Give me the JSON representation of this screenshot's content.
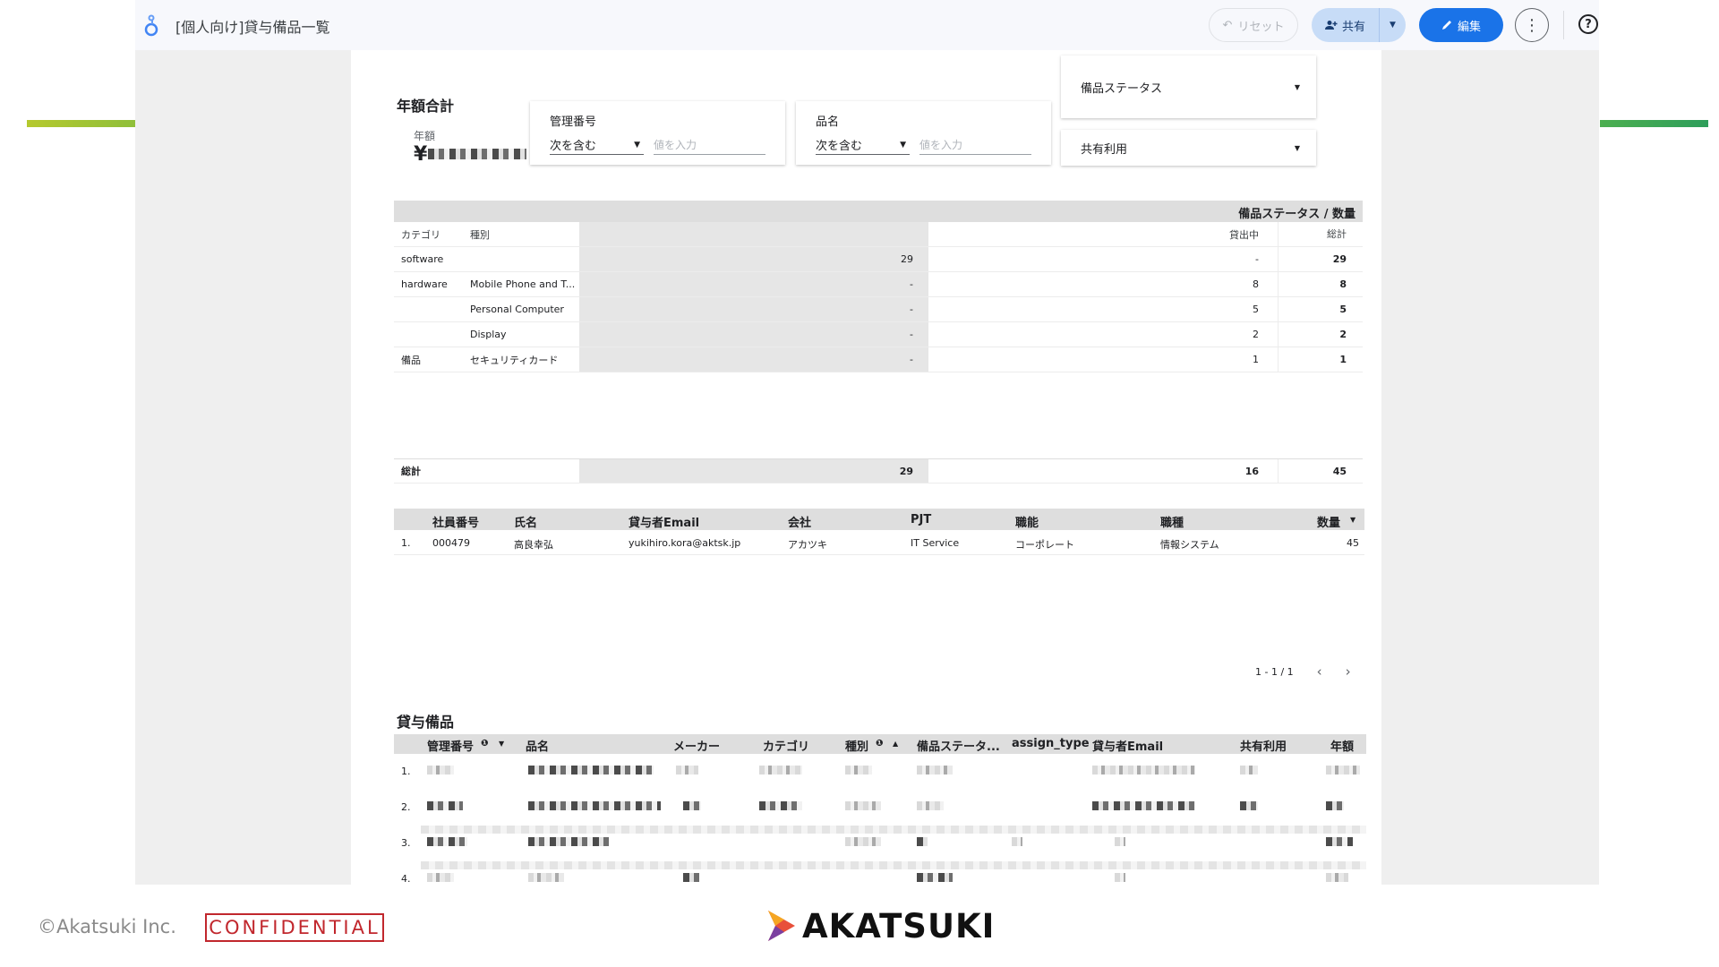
{
  "topbar": {
    "title": "[個人向け]貸与備品一覧",
    "reset_label": "リセット",
    "share_label": "共有",
    "edit_label": "編集"
  },
  "scorecard": {
    "title": "年額合計",
    "label": "年額",
    "currency": "¥"
  },
  "filters": {
    "mgmt": {
      "label": "管理番号",
      "mode": "次を含む",
      "placeholder": "値を入力"
    },
    "item": {
      "label": "品名",
      "mode": "次を含む",
      "placeholder": "値を入力"
    },
    "status_dropdown": "備品ステータス",
    "shared_dropdown": "共有利用"
  },
  "pivot": {
    "header": "備品ステータス / 数量",
    "col_category": "カテゴリ",
    "col_type": "種別",
    "col_lending": "貸出中",
    "col_total": "総計",
    "rows": [
      {
        "category": "software",
        "type": "",
        "a": "29",
        "b": "-",
        "total": "29"
      },
      {
        "category": "hardware",
        "type": "Mobile Phone and T...",
        "a": "-",
        "b": "8",
        "total": "8"
      },
      {
        "category": "",
        "type": "Personal Computer",
        "a": "-",
        "b": "5",
        "total": "5"
      },
      {
        "category": "",
        "type": "Display",
        "a": "-",
        "b": "2",
        "total": "2"
      },
      {
        "category": "備品",
        "type": "セキュリティカード",
        "a": "-",
        "b": "1",
        "total": "1"
      }
    ],
    "total_row": {
      "label": "総計",
      "a": "29",
      "b": "16",
      "total": "45"
    }
  },
  "owner_table": {
    "headers": {
      "emp_no": "社員番号",
      "name": "氏名",
      "email": "貸与者Email",
      "company": "会社",
      "pjt": "PJT",
      "role": "職能",
      "job": "職種",
      "qty": "数量"
    },
    "row": {
      "num": "1.",
      "emp_no": "000479",
      "name": "高良幸弘",
      "email": "yukihiro.kora@aktsk.jp",
      "company": "アカツキ",
      "pjt": "IT Service",
      "role": "コーポレート",
      "job": "情報システム",
      "qty": "45"
    }
  },
  "pager": {
    "range": "1 - 1 / 1"
  },
  "assets": {
    "title": "貸与備品",
    "headers": {
      "mgmt": "管理番号",
      "item": "品名",
      "maker": "メーカー",
      "category": "カテゴリ",
      "type": "種別",
      "status": "備品ステータ...",
      "assign": "assign_type",
      "email": "貸与者Email",
      "shared": "共有利用",
      "annual": "年額"
    },
    "row_nums": [
      "1.",
      "2.",
      "3.",
      "4."
    ]
  },
  "footer": {
    "copyright": "©Akatsuki Inc.",
    "confidential": "CONFIDENTIAL",
    "brand": "AKATSUKI"
  },
  "colors": {
    "accent": "#1a73e8",
    "share_bg": "#c7dcf7",
    "confidential": "#c1272d"
  }
}
